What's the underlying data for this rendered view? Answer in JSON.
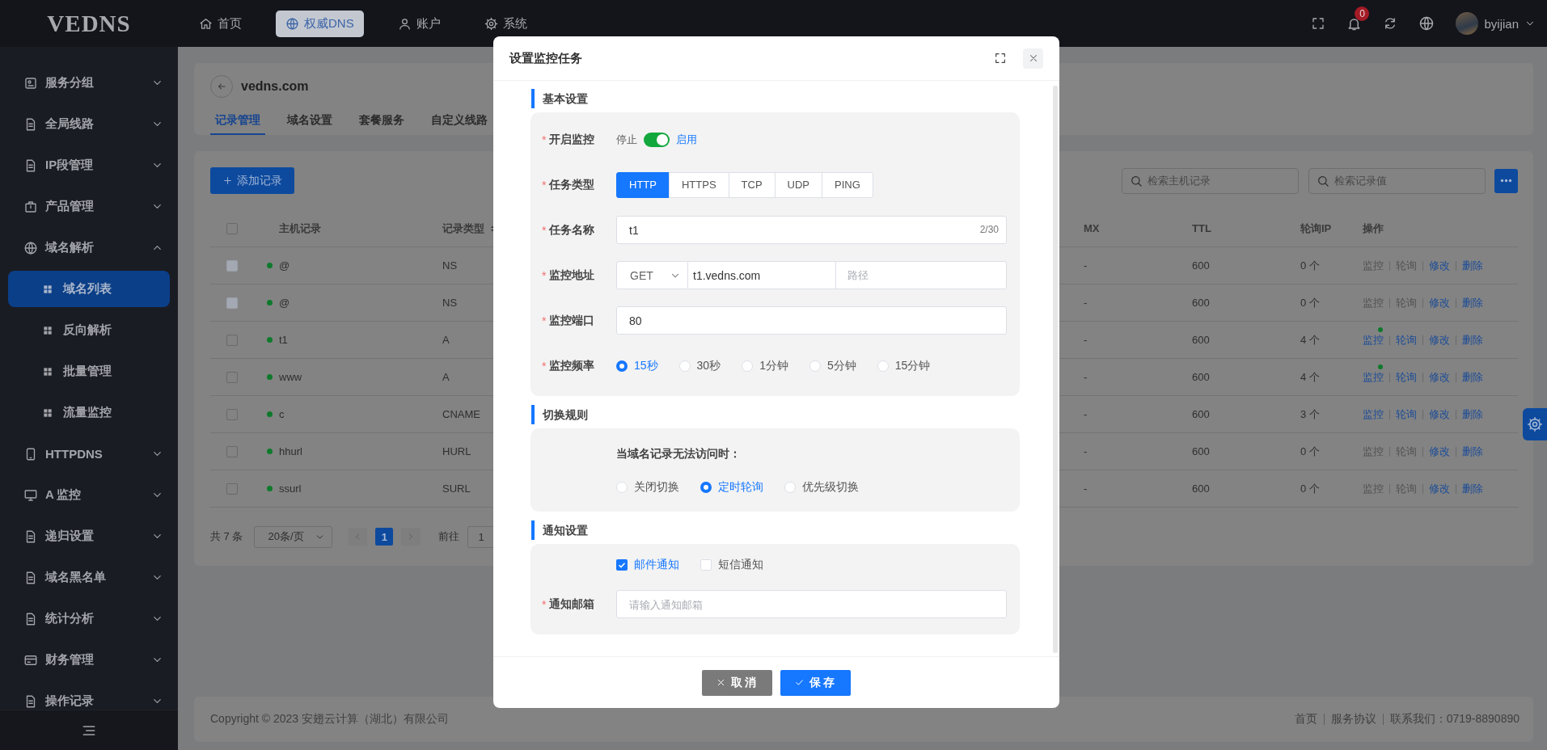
{
  "topbar": {
    "logo": "VEDNS",
    "nav": [
      {
        "label": "首页",
        "selected": false
      },
      {
        "label": "权威DNS",
        "selected": true
      },
      {
        "label": "账户",
        "selected": false
      },
      {
        "label": "系统",
        "selected": false
      }
    ],
    "notification_count": "0",
    "user": "byijian"
  },
  "sidebar": {
    "items": [
      {
        "label": "服务分组",
        "expanded": false
      },
      {
        "label": "全局线路",
        "expanded": false
      },
      {
        "label": "IP段管理",
        "expanded": false
      },
      {
        "label": "产品管理",
        "expanded": false
      },
      {
        "label": "域名解析",
        "expanded": true,
        "children": [
          {
            "label": "域名列表",
            "selected": true
          },
          {
            "label": "反向解析",
            "selected": false
          },
          {
            "label": "批量管理",
            "selected": false
          },
          {
            "label": "流量监控",
            "selected": false
          }
        ]
      },
      {
        "label": "HTTPDNS",
        "expanded": false
      },
      {
        "label": "A 监控",
        "expanded": false
      },
      {
        "label": "递归设置",
        "expanded": false
      },
      {
        "label": "域名黑名单",
        "expanded": false
      },
      {
        "label": "统计分析",
        "expanded": false
      },
      {
        "label": "财务管理",
        "expanded": false
      },
      {
        "label": "操作记录",
        "expanded": false
      }
    ]
  },
  "domain_header": {
    "domain": "vedns.com",
    "tabs": [
      {
        "label": "记录管理",
        "selected": true
      },
      {
        "label": "域名设置",
        "selected": false
      },
      {
        "label": "套餐服务",
        "selected": false
      },
      {
        "label": "自定义线路",
        "selected": false
      }
    ]
  },
  "records": {
    "add_button": "添加记录",
    "select_all": {
      "checked": false
    },
    "searches": [
      {
        "placeholder": "检索主机记录"
      },
      {
        "placeholder": "检索记录值"
      }
    ],
    "columns": [
      "主机记录",
      "记录类型",
      "MX",
      "TTL",
      "轮询IP",
      "操作"
    ],
    "rows": [
      {
        "disabled": true,
        "active": true,
        "host": "@",
        "type": "NS",
        "mx": "-",
        "ttl": "600",
        "ip_count": "0 个",
        "actions": [
          {
            "label": "监控",
            "enabled": false,
            "monitoring": false
          },
          {
            "label": "轮询",
            "enabled": false,
            "monitoring": false
          },
          {
            "label": "修改",
            "enabled": true,
            "monitoring": false
          },
          {
            "label": "删除",
            "enabled": true,
            "monitoring": false
          }
        ]
      },
      {
        "disabled": true,
        "active": true,
        "host": "@",
        "type": "NS",
        "mx": "-",
        "ttl": "600",
        "ip_count": "0 个",
        "actions": [
          {
            "label": "监控",
            "enabled": false,
            "monitoring": false
          },
          {
            "label": "轮询",
            "enabled": false,
            "monitoring": false
          },
          {
            "label": "修改",
            "enabled": true,
            "monitoring": false
          },
          {
            "label": "删除",
            "enabled": true,
            "monitoring": false
          }
        ]
      },
      {
        "disabled": false,
        "active": true,
        "host": "t1",
        "type": "A",
        "mx": "-",
        "ttl": "600",
        "ip_count": "4 个",
        "actions": [
          {
            "label": "监控",
            "enabled": true,
            "monitoring": true
          },
          {
            "label": "轮询",
            "enabled": true,
            "monitoring": false
          },
          {
            "label": "修改",
            "enabled": true,
            "monitoring": false
          },
          {
            "label": "删除",
            "enabled": true,
            "monitoring": false
          }
        ]
      },
      {
        "disabled": false,
        "active": true,
        "host": "www",
        "type": "A",
        "mx": "-",
        "ttl": "600",
        "ip_count": "4 个",
        "actions": [
          {
            "label": "监控",
            "enabled": true,
            "monitoring": true
          },
          {
            "label": "轮询",
            "enabled": true,
            "monitoring": false
          },
          {
            "label": "修改",
            "enabled": true,
            "monitoring": false
          },
          {
            "label": "删除",
            "enabled": true,
            "monitoring": false
          }
        ]
      },
      {
        "disabled": false,
        "active": true,
        "host": "c",
        "type": "CNAME",
        "mx": "-",
        "ttl": "600",
        "ip_count": "3 个",
        "actions": [
          {
            "label": "监控",
            "enabled": true,
            "monitoring": false
          },
          {
            "label": "轮询",
            "enabled": true,
            "monitoring": false
          },
          {
            "label": "修改",
            "enabled": true,
            "monitoring": false
          },
          {
            "label": "删除",
            "enabled": true,
            "monitoring": false
          }
        ]
      },
      {
        "disabled": false,
        "active": true,
        "host": "hhurl",
        "type": "HURL",
        "mx": "-",
        "ttl": "600",
        "ip_count": "0 个",
        "actions": [
          {
            "label": "监控",
            "enabled": false,
            "monitoring": false
          },
          {
            "label": "轮询",
            "enabled": false,
            "monitoring": false
          },
          {
            "label": "修改",
            "enabled": true,
            "monitoring": false
          },
          {
            "label": "删除",
            "enabled": true,
            "monitoring": false
          }
        ]
      },
      {
        "disabled": false,
        "active": true,
        "host": "ssurl",
        "type": "SURL",
        "mx": "-",
        "ttl": "600",
        "ip_count": "0 个",
        "actions": [
          {
            "label": "监控",
            "enabled": false,
            "monitoring": false
          },
          {
            "label": "轮询",
            "enabled": false,
            "monitoring": false
          },
          {
            "label": "修改",
            "enabled": true,
            "monitoring": false
          },
          {
            "label": "删除",
            "enabled": true,
            "monitoring": false
          }
        ]
      }
    ],
    "pagination": {
      "total": "共 7 条",
      "page_size": "20条/页",
      "pages": [
        {
          "label": "1",
          "selected": true
        }
      ],
      "goto_label": "前往",
      "goto_value": "1"
    }
  },
  "footer": {
    "copyright": "Copyright © 2023 安翅云计算（湖北）有限公司",
    "links": [
      "首页",
      "服务协议",
      "联系我们：0719-8890890"
    ]
  },
  "modal": {
    "title": "设置监控任务",
    "sections": [
      {
        "title": "基本设置",
        "fields": [
          {
            "kind": "switch",
            "label": "开启监控",
            "required_mark": "*",
            "off_label": "停止",
            "on_label": "启用",
            "on": true
          },
          {
            "kind": "segmented",
            "label": "任务类型",
            "required_mark": "*",
            "options": [
              {
                "label": "HTTP",
                "selected": true
              },
              {
                "label": "HTTPS",
                "selected": false
              },
              {
                "label": "TCP",
                "selected": false
              },
              {
                "label": "UDP",
                "selected": false
              },
              {
                "label": "PING",
                "selected": false
              }
            ]
          },
          {
            "kind": "text",
            "label": "任务名称",
            "required_mark": "*",
            "value": "t1",
            "counter": "2/30"
          },
          {
            "kind": "address",
            "label": "监控地址",
            "required_mark": "*",
            "method": "GET",
            "host": "t1.vedns.com",
            "path_placeholder": "路径"
          },
          {
            "kind": "text",
            "label": "监控端口",
            "required_mark": "*",
            "value": "80"
          },
          {
            "kind": "radio",
            "label": "监控频率",
            "required_mark": "*",
            "options": [
              {
                "label": "15秒",
                "selected": true
              },
              {
                "label": "30秒",
                "selected": false
              },
              {
                "label": "1分钟",
                "selected": false
              },
              {
                "label": "5分钟",
                "selected": false
              },
              {
                "label": "15分钟",
                "selected": false
              }
            ]
          }
        ]
      },
      {
        "title": "切换规则",
        "fields": [
          {
            "kind": "note",
            "text": "当域名记录无法访问时："
          },
          {
            "kind": "radio",
            "options": [
              {
                "label": "关闭切换",
                "selected": false
              },
              {
                "label": "定时轮询",
                "selected": true
              },
              {
                "label": "优先级切换",
                "selected": false
              }
            ]
          }
        ]
      },
      {
        "title": "通知设置",
        "fields": [
          {
            "kind": "checks",
            "options": [
              {
                "label": "邮件通知",
                "checked": true
              },
              {
                "label": "短信通知",
                "checked": false
              }
            ]
          },
          {
            "kind": "text",
            "label": "通知邮箱",
            "required_mark": "*",
            "placeholder": "请输入通知邮箱"
          }
        ]
      }
    ],
    "buttons": [
      {
        "kind": "cancel",
        "label": "取消"
      },
      {
        "kind": "save",
        "label": "保存"
      }
    ]
  }
}
